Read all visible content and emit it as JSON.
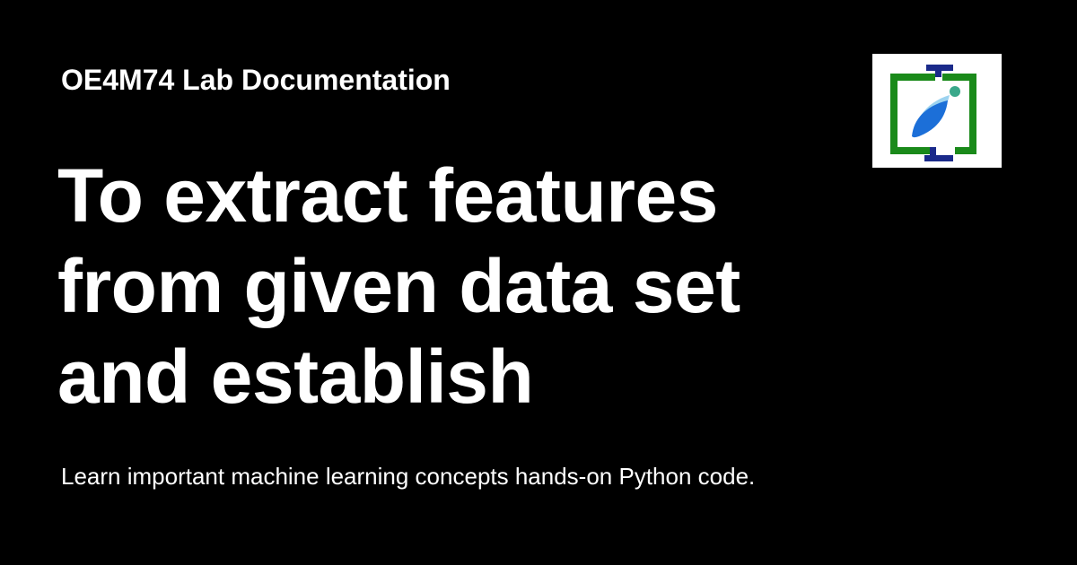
{
  "site": {
    "name": "OE4M74 Lab Documentation"
  },
  "page": {
    "title": "To extract features from given data set and establish",
    "description": "Learn important machine learning concepts hands-on Python code."
  },
  "logo": {
    "icon": "jupyter-book-logo-icon"
  },
  "colors": {
    "background": "#000000",
    "text": "#ffffff",
    "logo_green": "#1a8a1a",
    "logo_navy": "#1a2a8a",
    "logo_blue": "#1c6fd8",
    "logo_teal": "#3aa88a"
  }
}
